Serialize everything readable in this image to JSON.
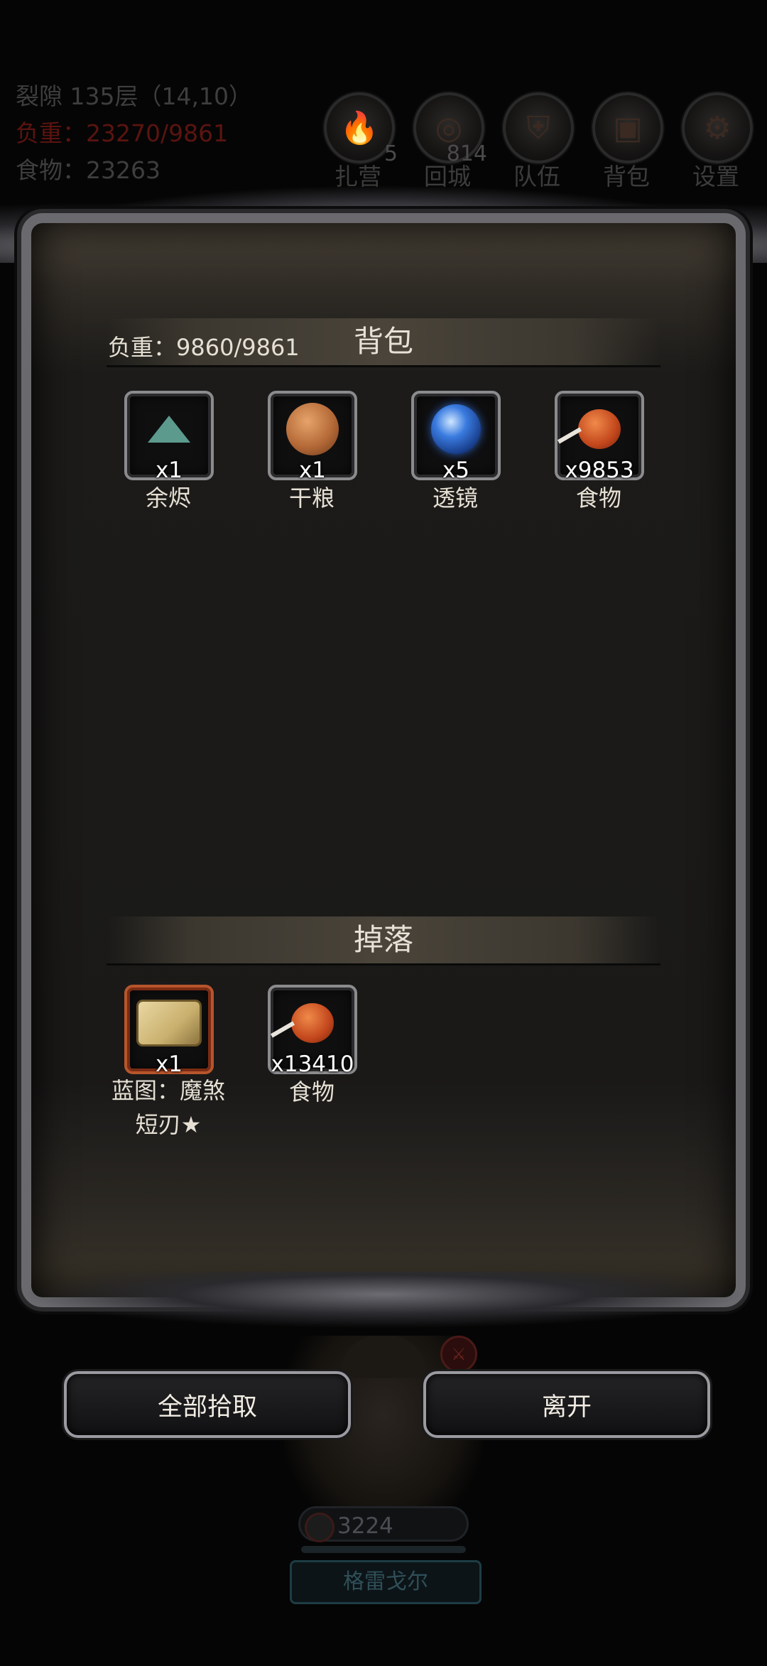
{
  "hud": {
    "location": "裂隙 135层（14,10）",
    "load": "负重：23270/9861",
    "food": "食物：23263",
    "buttons": [
      {
        "icon": "campfire-icon",
        "badge": "5",
        "label": "扎营"
      },
      {
        "icon": "portal-icon",
        "badge": "814",
        "label": "回城"
      },
      {
        "icon": "shield-icon",
        "badge": "",
        "label": "队伍"
      },
      {
        "icon": "chest-icon",
        "badge": "",
        "label": "背包"
      },
      {
        "icon": "gear-icon",
        "badge": "",
        "label": "设置"
      }
    ]
  },
  "backpack": {
    "title": "背包",
    "weight": "负重：9860/9861",
    "items": [
      {
        "icon": "ember-pyramid-icon",
        "qty": "x1",
        "name": "余烬"
      },
      {
        "icon": "ration-cake-icon",
        "qty": "x1",
        "name": "干粮"
      },
      {
        "icon": "lens-orb-icon",
        "qty": "x5",
        "name": "透镜"
      },
      {
        "icon": "meat-drumstick-icon",
        "qty": "x9853",
        "name": "食物"
      }
    ]
  },
  "drops": {
    "title": "掉落",
    "items": [
      {
        "icon": "blueprint-scroll-icon",
        "qty": "x1",
        "name": "蓝图：魔煞",
        "name2": "短刃★"
      },
      {
        "icon": "meat-drumstick-icon",
        "qty": "x13410",
        "name": "食物"
      }
    ]
  },
  "actions": {
    "pickup_all": "全部拾取",
    "leave": "离开"
  },
  "character": {
    "hp": "3224",
    "name": "格雷戈尔"
  }
}
